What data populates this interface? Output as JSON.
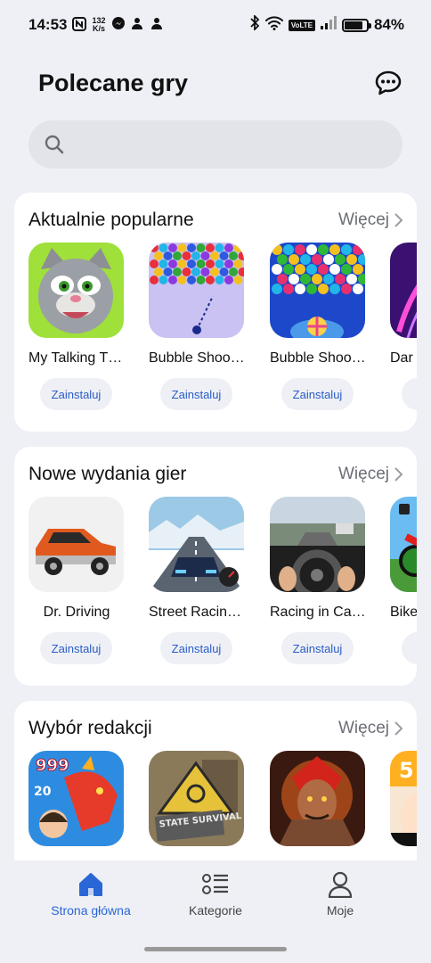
{
  "status": {
    "time": "14:53",
    "speed_top": "132",
    "speed_bottom": "K/s",
    "volte": "VoLTE",
    "battery": "84%",
    "battery_level": 0.84
  },
  "header": {
    "title": "Polecane gry",
    "chat_icon": "chat-bubble-icon"
  },
  "search": {
    "placeholder": "",
    "icon": "search-icon"
  },
  "sections": [
    {
      "title": "Aktualnie popularne",
      "more": "Więcej",
      "apps": [
        {
          "name": "My Talking T…",
          "action": "Zainstaluj"
        },
        {
          "name": "Bubble Shoo…",
          "action": "Zainstaluj"
        },
        {
          "name": "Bubble Shoo…",
          "action": "Zainstaluj"
        },
        {
          "name": "Dar",
          "action": "Z"
        }
      ]
    },
    {
      "title": "Nowe wydania gier",
      "more": "Więcej",
      "apps": [
        {
          "name": "Dr. Driving",
          "action": "Zainstaluj"
        },
        {
          "name": "Street Racin…",
          "action": "Zainstaluj"
        },
        {
          "name": "Racing in Ca…",
          "action": "Zainstaluj"
        },
        {
          "name": "Bike",
          "action": "Z"
        }
      ]
    },
    {
      "title": "Wybór redakcji",
      "more": "Więcej",
      "apps": [
        {
          "name": "",
          "badge_top": "999",
          "badge_mid": "20"
        },
        {
          "name": "",
          "sign_text": "STATE SURVIVAL"
        },
        {
          "name": ""
        },
        {
          "name": "",
          "badge_top": "5"
        }
      ]
    }
  ],
  "nav": {
    "home": "Strona główna",
    "categories": "Kategorie",
    "profile": "Moje"
  },
  "colors": {
    "accent": "#2a66d6",
    "install_text": "#2a5cc8",
    "background": "#eef0f5"
  }
}
